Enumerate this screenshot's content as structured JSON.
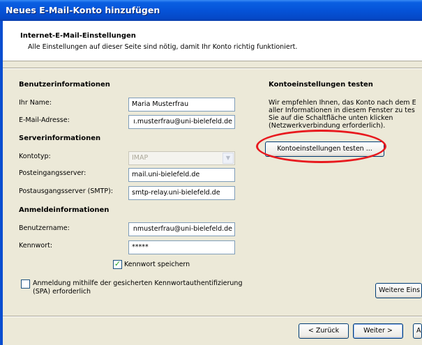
{
  "window": {
    "title": "Neues E-Mail-Konto hinzufügen"
  },
  "header": {
    "title": "Internet-E-Mail-Einstellungen",
    "subtitle": "Alle Einstellungen auf dieser Seite sind nötig, damit Ihr Konto richtig funktioniert."
  },
  "user_info": {
    "heading": "Benutzerinformationen",
    "name_label": "Ihr Name:",
    "name_value": "Maria Musterfrau",
    "email_label": "E-Mail-Adresse:",
    "email_value": "ı.musterfrau@uni-bielefeld.de"
  },
  "server_info": {
    "heading": "Serverinformationen",
    "account_type_label": "Kontotyp:",
    "account_type_value": "IMAP",
    "incoming_label": "Posteingangsserver:",
    "incoming_value": "mail.uni-bielefeld.de",
    "outgoing_label": "Postausgangsserver (SMTP):",
    "outgoing_value": "smtp-relay.uni-bielefeld.de"
  },
  "login_info": {
    "heading": "Anmeldeinformationen",
    "username_label": "Benutzername:",
    "username_value": "nmusterfrau@uni-bielefeld.de",
    "password_label": "Kennwort:",
    "password_value": "*****",
    "remember_label": "Kennwort speichern",
    "remember_checked": true,
    "spa_label_line1": "Anmeldung mithilfe der gesicherten Kennwortauthentifizierung",
    "spa_label_line2": "(SPA) erforderlich",
    "spa_checked": false
  },
  "test_settings": {
    "heading": "Kontoeinstellungen testen",
    "description_lines": [
      "Wir empfehlen Ihnen, das Konto nach dem E",
      "aller Informationen in diesem Fenster zu tes",
      "Sie auf die Schaltfläche unten klicken",
      "(Netzwerkverbindung erforderlich)."
    ],
    "test_button": "Kontoeinstellungen testen ...",
    "more_settings_button": "Weitere Eins",
    "highlight_color": "#e8191e"
  },
  "footer": {
    "back_button": "< Zurück",
    "next_button": "Weiter >",
    "cancel_button_partial": "A"
  },
  "colors": {
    "titlebar": "#0553d8",
    "dialog": "#ece9d8",
    "checkmark": "#21a121"
  }
}
